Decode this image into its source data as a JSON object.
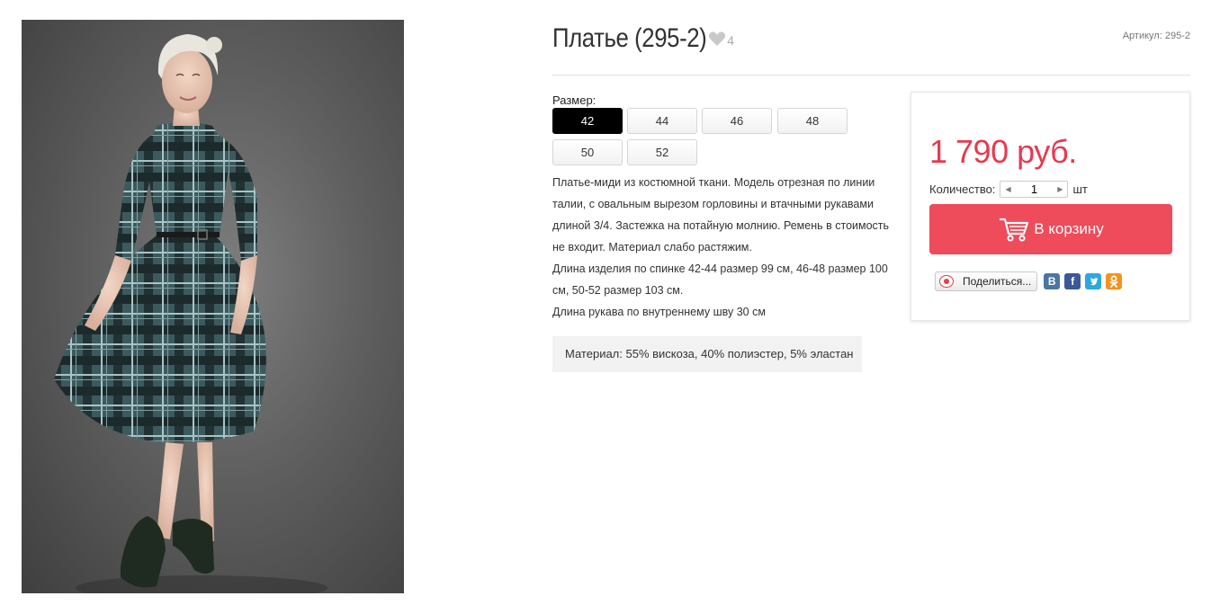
{
  "product": {
    "title": "Платье (295-2)",
    "favorites_count": "4",
    "sku_label": "Артикул:",
    "sku_value": "295-2"
  },
  "sizes": {
    "label": "Размер:",
    "options": [
      "42",
      "44",
      "46",
      "48",
      "50",
      "52"
    ],
    "selected": "42"
  },
  "description": {
    "paragraphs": [
      "Платье-миди из костюмной ткани. Модель отрезная по линии талии, с овальным вырезом горловины и втачными рукавами длиной 3/4. Застежка на потайную молнию. Ремень в стоимость не входит. Материал слабо растяжим.",
      "Длина изделия по спинке 42-44 размер 99 см, 46-48 размер 100 см, 50-52 размер 103 см.",
      "Длина рукава по внутреннему шву  30 см"
    ],
    "material": "Материал: 55% вискоза, 40% полиэстер, 5% эластан"
  },
  "buy": {
    "price": "1 790 руб.",
    "quantity_label": "Количество:",
    "quantity_value": "1",
    "quantity_unit": "шт",
    "cart_button": "В корзину",
    "share_button": "Поделиться...",
    "social": [
      {
        "name": "vk",
        "glyph": "B"
      },
      {
        "name": "facebook",
        "glyph": "f"
      },
      {
        "name": "twitter",
        "glyph": "t"
      },
      {
        "name": "odnoklassniki",
        "glyph": "ok"
      }
    ]
  },
  "colors": {
    "price": "#e53a4f",
    "cart_button": "#ee4b5b",
    "size_selected": "#000000"
  }
}
